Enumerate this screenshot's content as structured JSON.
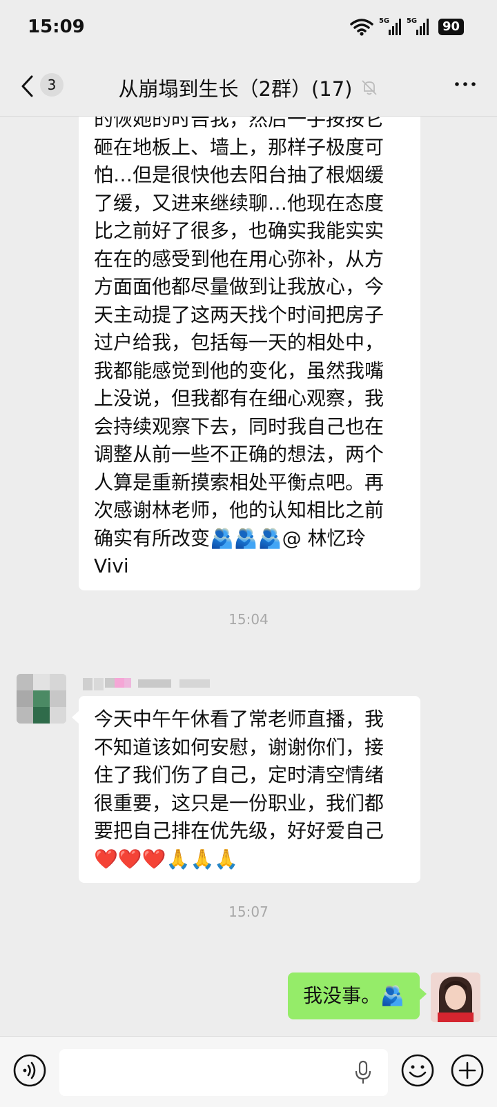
{
  "status_bar": {
    "time": "15:09",
    "signal_labels": [
      "5G",
      "5G"
    ],
    "battery": "90"
  },
  "header": {
    "unread_count": "3",
    "title": "从崩塌到生长（2群）(17)"
  },
  "messages": [
    {
      "text": "的恢她的时告我，然后一手按按它\n砸在地板上、墙上，那样子极度可\n怕…但是很快他去阳台抽了根烟缓\n了缓，又进来继续聊…他现在态度\n比之前好了很多，也确实我能实实\n在在的感受到他在用心弥补，从方\n方面面他都尽量做到让我放心，今\n天主动提了这两天找个时间把房子\n过户给我，包括每一天的相处中，\n我都能感觉到他的变化，虽然我嘴\n上没说，但我都有在细心观察，我\n会持续观察下去，同时我自己也在\n调整从前一些不正确的想法，两个\n人算是重新摸索相处平衡点吧。再\n次感谢林老师，他的认知相比之前\n确实有所改变🫂🫂🫂@ 林忆玲\nVivi"
    },
    {
      "timestamp": "15:04"
    },
    {
      "text": "今天中午午休看了常老师直播，我\n不知道该如何安慰，谢谢你们，接\n住了我们伤了自己，定时清空情绪\n很重要，这只是一份职业，我们都\n要把自己排在优先级，好好爱自己\n❤️❤️❤️🙏🙏🙏"
    },
    {
      "timestamp": "15:07"
    },
    {
      "text": "我没事。🫂"
    }
  ],
  "input": {
    "placeholder": "",
    "value": ""
  },
  "colors": {
    "my_bubble": "#95ec69",
    "background": "#ededed"
  }
}
